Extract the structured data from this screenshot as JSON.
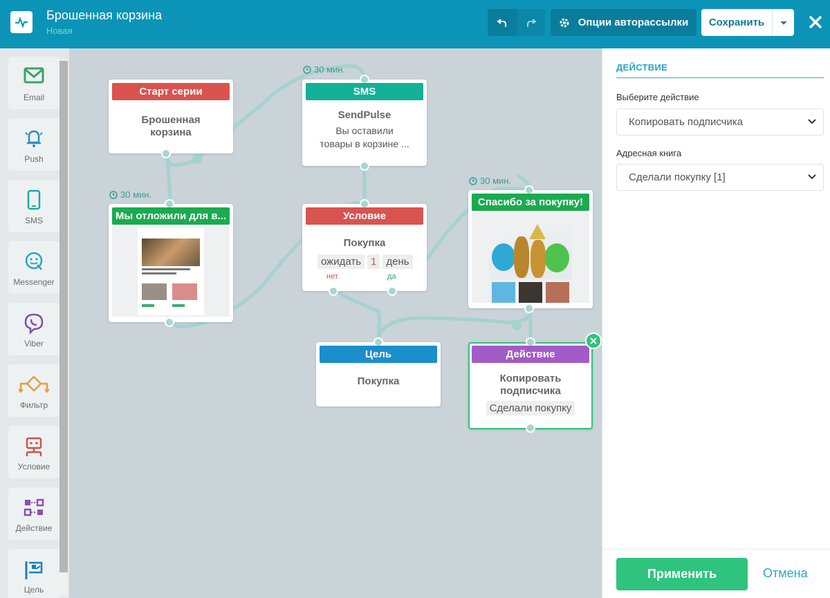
{
  "header": {
    "title": "Брошенная корзина",
    "status": "Новая",
    "options_label": "Опции авторассылки",
    "save_label": "Сохранить"
  },
  "palette": {
    "items": [
      {
        "label": "Email",
        "icon": "email-icon"
      },
      {
        "label": "Push",
        "icon": "bell-icon"
      },
      {
        "label": "SMS",
        "icon": "phone-icon"
      },
      {
        "label": "Messenger",
        "icon": "messenger-icon"
      },
      {
        "label": "Viber",
        "icon": "viber-icon"
      },
      {
        "label": "Фильтр",
        "icon": "filter-icon"
      },
      {
        "label": "Условие",
        "icon": "condition-icon"
      },
      {
        "label": "Действие",
        "icon": "action-icon"
      },
      {
        "label": "Цель",
        "icon": "goal-icon"
      }
    ]
  },
  "canvas": {
    "delay_text": "30 мин.",
    "nodes": {
      "start": {
        "header": "Старт серии",
        "line1": "Брошенная",
        "line2": "корзина"
      },
      "sms": {
        "header": "SMS",
        "sender": "SendPulse",
        "text1": "Вы оставили",
        "text2": "товары в корзине ..."
      },
      "email1": {
        "header": "Мы отложили для в..."
      },
      "condition": {
        "header": "Условие",
        "title": "Покупка",
        "wait": "ожидать",
        "num": "1",
        "unit": "день",
        "no": "нет",
        "yes": "да"
      },
      "email2": {
        "header": "Спасибо за покупку!"
      },
      "goal": {
        "header": "Цель",
        "title": "Покупка"
      },
      "action": {
        "header": "Действие",
        "line1": "Копировать",
        "line2": "подписчика",
        "book": "Сделали покупку"
      }
    }
  },
  "panel": {
    "title": "ДЕЙСТВИЕ",
    "action_label": "Выберите действие",
    "action_value": "Копировать подписчика",
    "book_label": "Адресная книга",
    "book_value": "Сделали покупку [1]",
    "apply_label": "Применить",
    "cancel_label": "Отмена"
  },
  "colors": {
    "header_bg": "#0c93b8",
    "start": "#d9534f",
    "sms": "#14b098",
    "email": "#1aab4f",
    "condition": "#d9534f",
    "goal": "#1a8fcc",
    "action": "#a35bc8",
    "apply": "#2fc47e"
  }
}
